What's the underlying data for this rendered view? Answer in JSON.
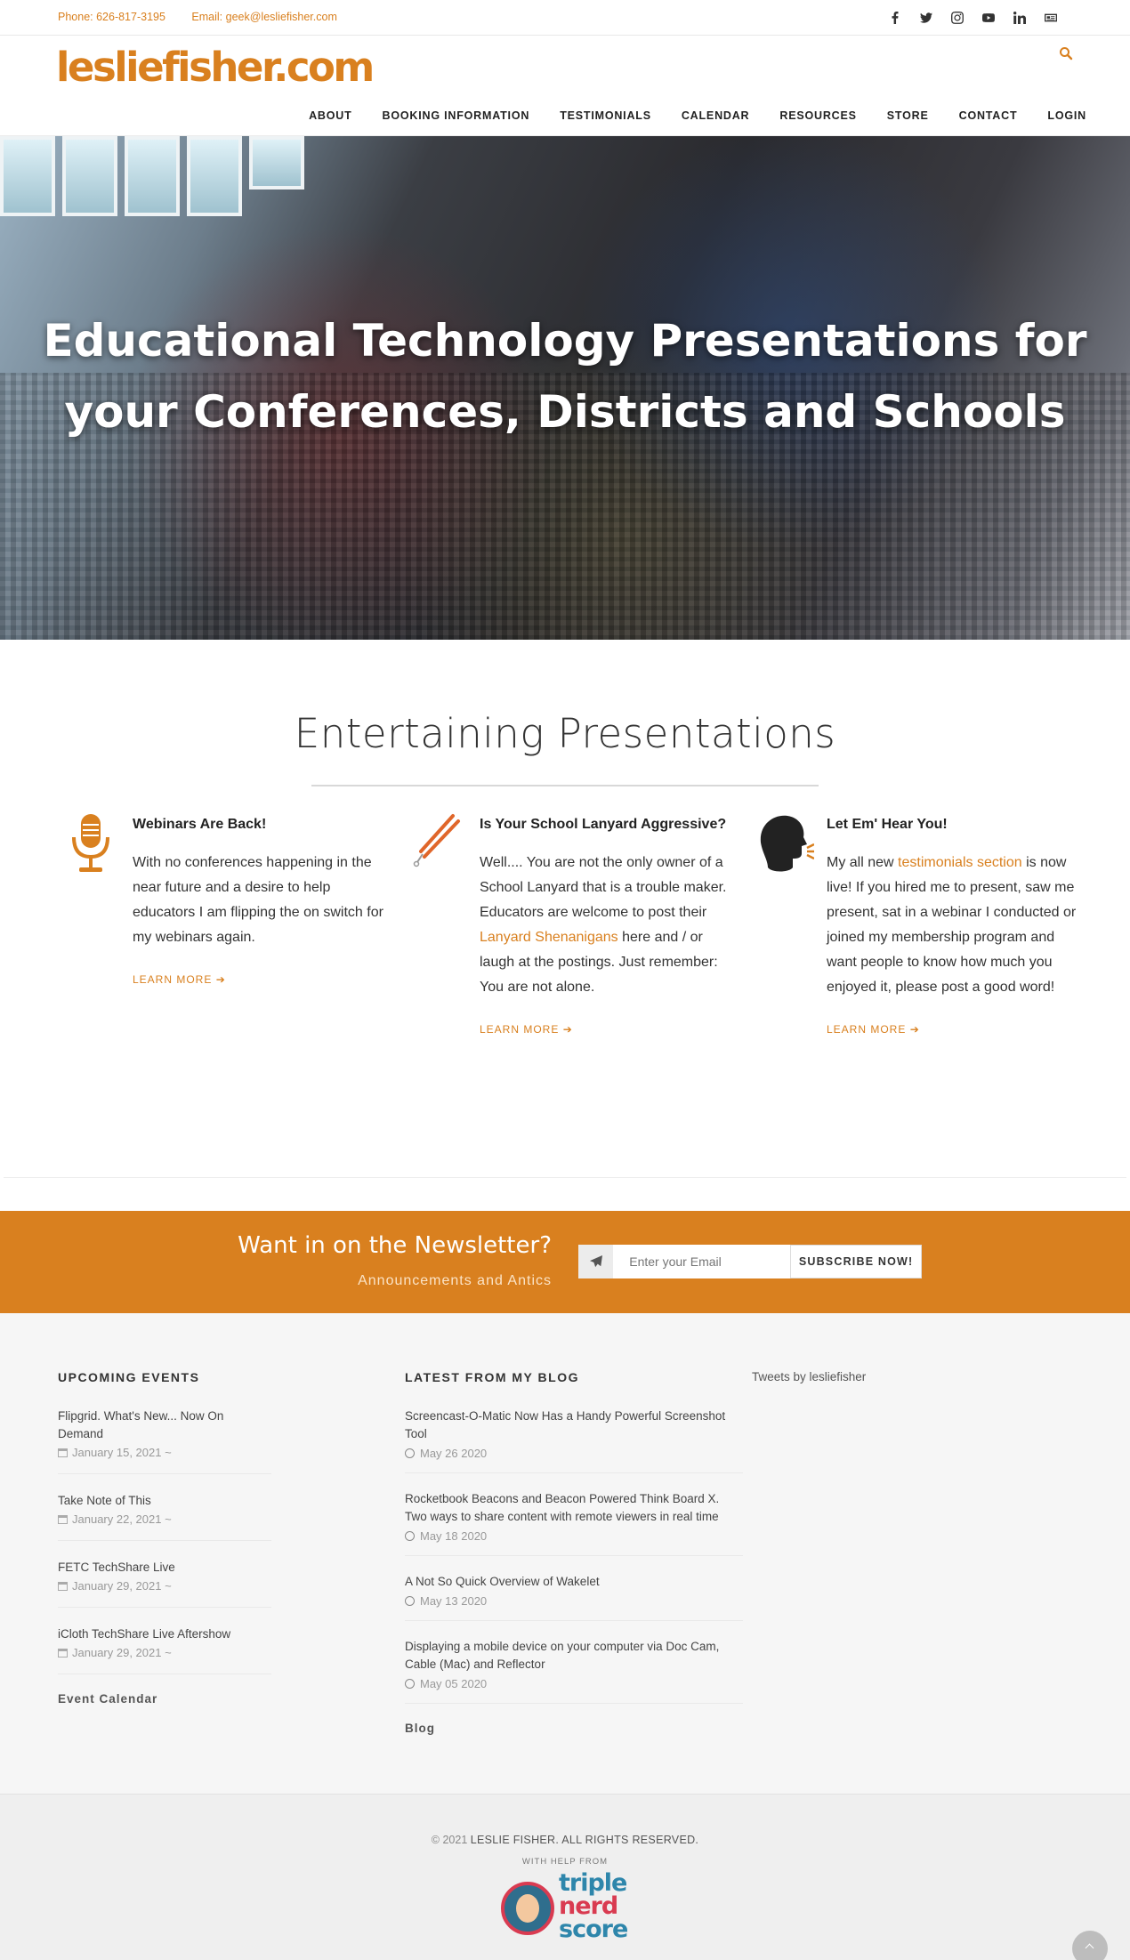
{
  "topbar": {
    "phone": "Phone: 626-817-3195",
    "email": "Email: geek@lesliefisher.com",
    "social": [
      "facebook-icon",
      "twitter-icon",
      "instagram-icon",
      "youtube-icon",
      "linkedin-icon",
      "newsletter-icon"
    ]
  },
  "header": {
    "logo": "lesliefisher.com",
    "nav": [
      "ABOUT",
      "BOOKING INFORMATION",
      "TESTIMONIALS",
      "CALENDAR",
      "RESOURCES",
      "STORE",
      "CONTACT",
      "LOGIN"
    ]
  },
  "hero": {
    "line1": "Educational Technology Presentations for",
    "line2": "your Conferences, Districts and Schools"
  },
  "presentations": {
    "title": "Entertaining Presentations",
    "items": [
      {
        "title": "Webinars Are Back!",
        "text": "With no conferences happening in the near future and a desire to help educators I am flipping the on switch for my webinars again.",
        "more": "LEARN MORE"
      },
      {
        "title": "Is Your School Lanyard Aggressive?",
        "text_before": "Well.... You are not the only owner of a School Lanyard that is a trouble maker. Educators are welcome to post their ",
        "link": "Lanyard Shenanigans",
        "text_after": " here and / or laugh at the postings. Just remember: You are not alone.",
        "more": "LEARN MORE"
      },
      {
        "title": "Let Em' Hear You!",
        "text_before": "My all new ",
        "link": "testimonials section",
        "text_after": " is now live! If you hired me to present, saw me present, sat in a webinar I conducted or joined my membership program and want people to know how much you enjoyed it, please post a good word!",
        "more": "LEARN MORE"
      }
    ]
  },
  "newsletter": {
    "title": "Want in on the Newsletter?",
    "subtitle": "Announcements and Antics",
    "placeholder": "Enter your Email",
    "button": "SUBSCRIBE NOW!"
  },
  "events": {
    "heading": "UPCOMING EVENTS",
    "items": [
      {
        "title": "Flipgrid. What's New... Now On Demand",
        "date": "January 15, 2021 ~"
      },
      {
        "title": "Take Note of This",
        "date": "January 22, 2021 ~"
      },
      {
        "title": "FETC TechShare Live",
        "date": "January 29, 2021 ~"
      },
      {
        "title": "iCloth TechShare Live Aftershow",
        "date": "January 29, 2021 ~"
      }
    ],
    "link": "Event Calendar"
  },
  "blog": {
    "heading": "LATEST FROM MY BLOG",
    "items": [
      {
        "title": "Screencast-O-Matic Now Has a Handy Powerful Screenshot Tool",
        "date": "May 26 2020"
      },
      {
        "title": "Rocketbook Beacons and Beacon Powered Think Board X. Two ways to share content with remote viewers in real time",
        "date": "May 18 2020"
      },
      {
        "title": "A Not So Quick Overview of Wakelet",
        "date": "May 13 2020"
      },
      {
        "title": "Displaying a mobile device on your computer via Doc Cam, Cable (Mac) and Reflector",
        "date": "May 05 2020"
      }
    ],
    "link": "Blog"
  },
  "tweets": "Tweets by lesliefisher",
  "footer": {
    "copy_prefix": "© 2021 ",
    "copy_org": "LESLIE FISHER. ALL RIGHTS RESERVED.",
    "help": "WITH HELP FROM",
    "brand_words": [
      "triple",
      "nerd",
      "score"
    ]
  },
  "colors": {
    "accent": "#d9801f",
    "dark": "#222222",
    "tns_blue": "#2e86ab",
    "tns_red": "#d93b51"
  }
}
